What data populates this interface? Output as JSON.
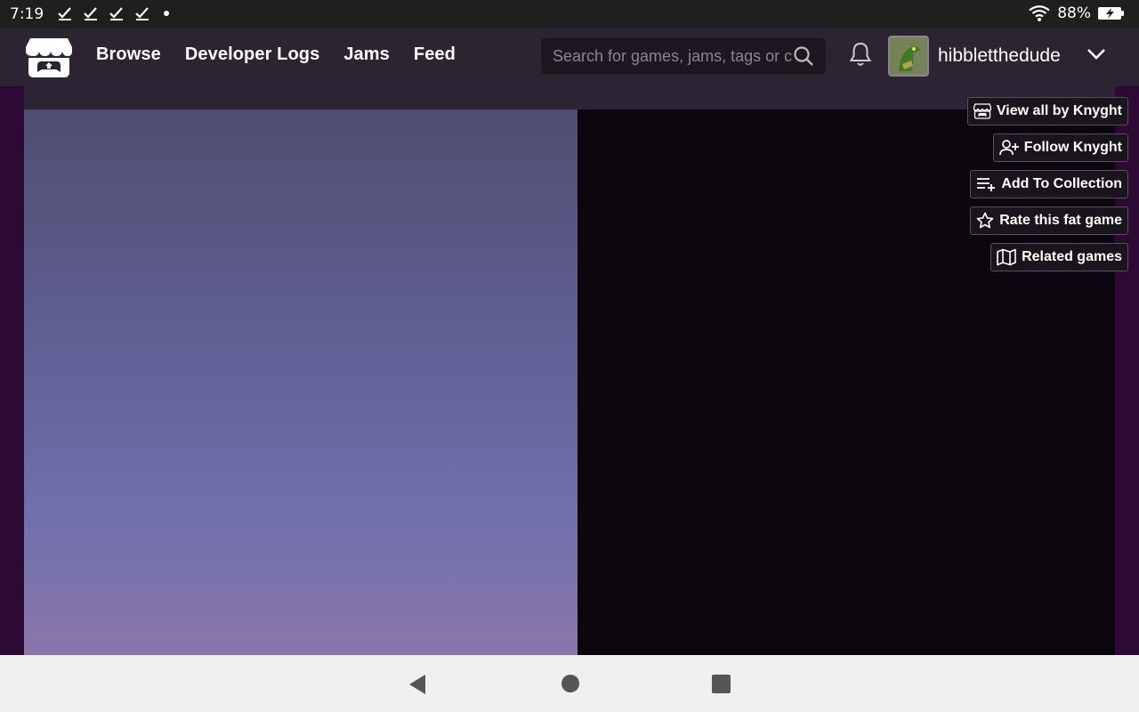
{
  "status_bar": {
    "time": "7:19",
    "battery_percent": "88%",
    "notification_icons": [
      "check-notification-icon",
      "check-notification-icon",
      "check-notification-icon",
      "check-notification-icon",
      "more-dot-icon"
    ],
    "right_icons": [
      "wifi-icon",
      "battery-charging-icon"
    ]
  },
  "header": {
    "logo_icon": "itchio-logo-icon",
    "nav": [
      "Browse",
      "Developer Logs",
      "Jams",
      "Feed"
    ],
    "search": {
      "placeholder": "Search for games, jams, tags or creators",
      "value": ""
    },
    "notifications_icon": "bell-icon",
    "username": "hibbletthedude",
    "menu_icon": "chevron-down-icon"
  },
  "actions": [
    {
      "label": "View all by Knyght",
      "icon": "itchio-small-icon"
    },
    {
      "label": "Follow Knyght",
      "icon": "user-plus-icon"
    },
    {
      "label": "Add To Collection",
      "icon": "list-add-icon"
    },
    {
      "label": "Rate this fat game",
      "icon": "star-icon"
    },
    {
      "label": "Related games",
      "icon": "map-icon"
    }
  ],
  "android_nav": [
    "back-icon",
    "home-icon",
    "recents-icon"
  ],
  "colors": {
    "header_bg": "#2c2430",
    "page_bg": "#2d0a33",
    "embed_dark": "#0c070e",
    "gradient_top": "#4f4d6f",
    "gradient_bottom": "#8a77aa"
  }
}
